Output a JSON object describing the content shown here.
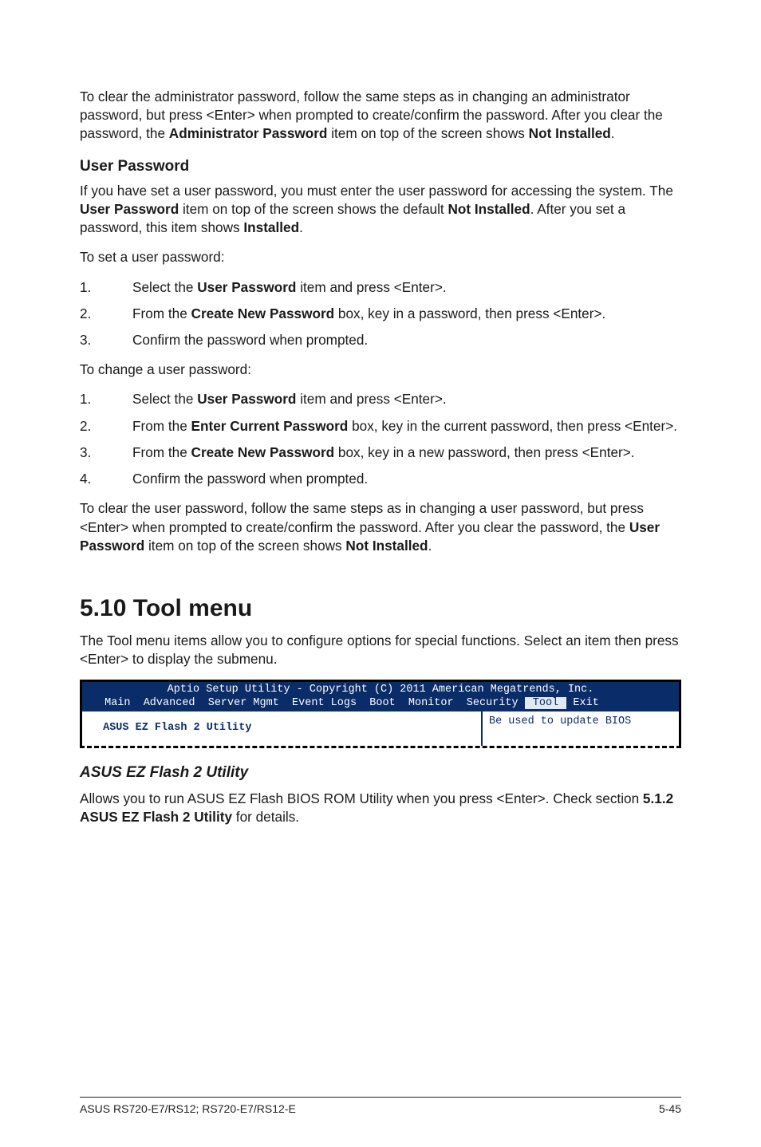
{
  "intro_clear_admin": {
    "line1": "To clear the administrator password, follow the same steps as in changing an administrator password, but press <Enter> when prompted to create/confirm the password. After you clear the password, the ",
    "bold1": "Administrator Password",
    "line2": " item on top of the screen shows ",
    "bold2": "Not Installed",
    "line3": "."
  },
  "user_password_heading": "User Password",
  "user_password_desc": {
    "p1a": "If you have set a user password, you must enter the user password for accessing the system. The ",
    "b1": "User Password",
    "p1b": " item on top of the screen shows the default ",
    "b2": "Not Installed",
    "p1c": ". After you set a password, this item shows ",
    "b3": "Installed",
    "p1d": "."
  },
  "set_intro": "To set a user password:",
  "set_steps": [
    {
      "a": "Select the ",
      "b": "User Password",
      "c": " item and press <Enter>."
    },
    {
      "a": "From the ",
      "b": "Create New Password",
      "c": " box, key in a password, then press <Enter>."
    },
    {
      "a": "Confirm the password when prompted.",
      "b": "",
      "c": ""
    }
  ],
  "change_intro": "To change a user password:",
  "change_steps": [
    {
      "a": "Select the ",
      "b": "User Password",
      "c": " item and press <Enter>."
    },
    {
      "a": "From the ",
      "b": "Enter Current Password",
      "c": " box, key in the current password, then press <Enter>."
    },
    {
      "a": "From the ",
      "b": "Create New Password",
      "c": " box, key in a new password, then press <Enter>."
    },
    {
      "a": "Confirm the password when prompted.",
      "b": "",
      "c": ""
    }
  ],
  "clear_user": {
    "a": "To clear the user password, follow the same steps as in changing a user password, but press <Enter> when prompted to create/confirm the password. After you clear the password, the ",
    "b": "User Password",
    "c": " item on top of the screen shows ",
    "d": "Not Installed",
    "e": "."
  },
  "section_title": "5.10   Tool menu",
  "section_desc": "The Tool menu items allow you to configure options for special functions. Select an item then press <Enter> to display the submenu.",
  "bios": {
    "title": "Aptio Setup Utility - Copyright (C) 2011 American Megatrends, Inc.",
    "tabs_pre": " Main  Advanced  Server Mgmt  Event Logs  Boot  Monitor  Security ",
    "tab_selected": " Tool ",
    "tabs_post": " Exit",
    "left": " ASUS EZ Flash 2 Utility",
    "right": "Be used to update BIOS"
  },
  "ezflash_heading": "ASUS EZ Flash 2 Utility",
  "ezflash_desc": {
    "a": "Allows you to run ASUS EZ Flash BIOS ROM Utility when you press <Enter>. Check section ",
    "b": "5.1.2 ASUS EZ Flash 2 Utility",
    "c": " for details."
  },
  "footer_left": "ASUS RS720-E7/RS12; RS720-E7/RS12-E",
  "footer_right": "5-45"
}
